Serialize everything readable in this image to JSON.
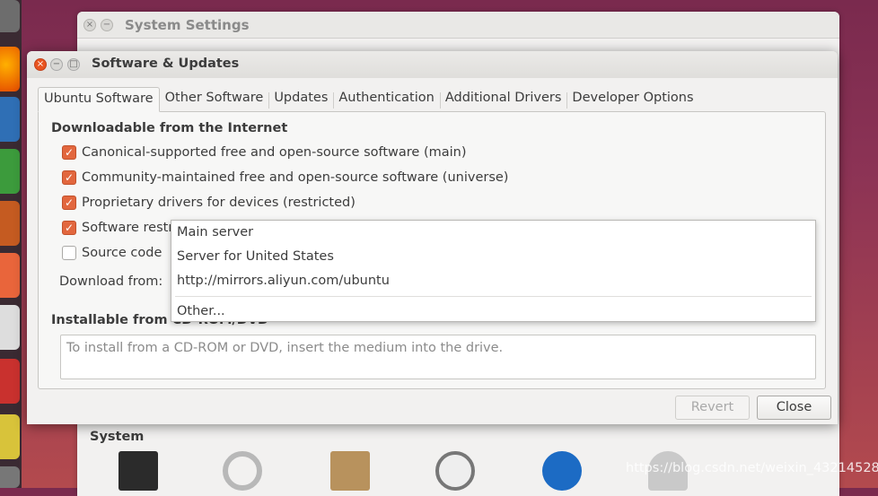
{
  "back_window": {
    "title": "System Settings",
    "section_label": "System"
  },
  "dialog": {
    "title": "Software & Updates",
    "tabs": [
      {
        "label": "Ubuntu Software",
        "active": true
      },
      {
        "label": "Other Software",
        "active": false
      },
      {
        "label": "Updates",
        "active": false
      },
      {
        "label": "Authentication",
        "active": false
      },
      {
        "label": "Additional Drivers",
        "active": false
      },
      {
        "label": "Developer Options",
        "active": false
      }
    ],
    "downloadable_title": "Downloadable from the Internet",
    "checkboxes": [
      {
        "label": "Canonical-supported free and open-source software (main)",
        "checked": true
      },
      {
        "label": "Community-maintained free and open-source software (universe)",
        "checked": true
      },
      {
        "label": "Proprietary drivers for devices (restricted)",
        "checked": true
      },
      {
        "label": "Software restr",
        "checked": true
      },
      {
        "label": "Source code",
        "checked": false
      }
    ],
    "download_from_label": "Download from:",
    "installable_title": "Installable from CD-ROM/DVD",
    "cd_placeholder": "To install from a CD-ROM or DVD, insert the medium into the drive.",
    "revert_label": "Revert",
    "close_label": "Close"
  },
  "dropdown": {
    "items": [
      "Main server",
      "Server for United States",
      "http://mirrors.aliyun.com/ubuntu"
    ],
    "other_label": "Other..."
  },
  "watermark": "https://blog.csdn.net/weixin_43214528",
  "colors": {
    "accent": "#e95420",
    "checkbox_on": "#e2673e"
  }
}
